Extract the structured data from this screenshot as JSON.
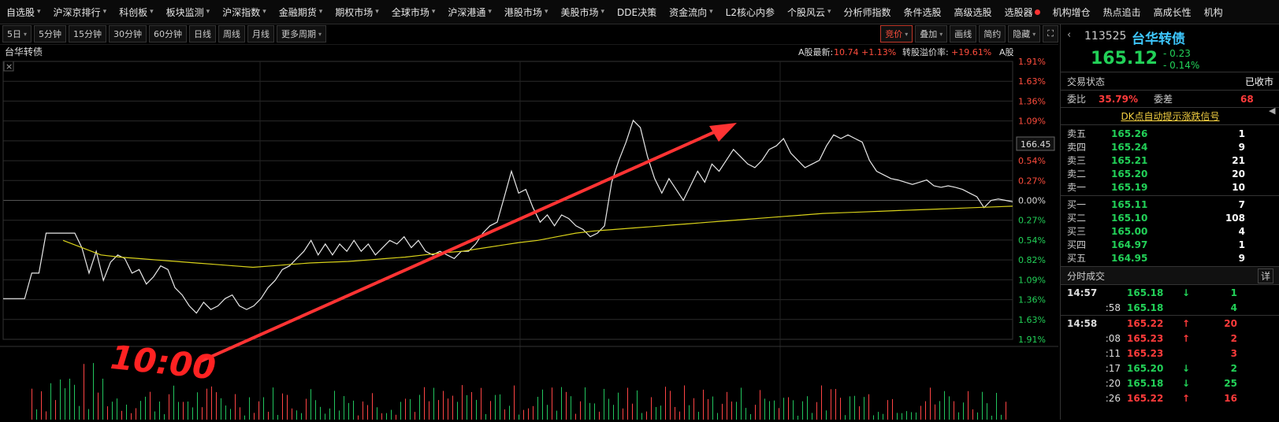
{
  "menu": [
    {
      "label": "自选股",
      "arrow": true
    },
    {
      "label": "沪深京排行",
      "arrow": true
    },
    {
      "label": "科创板",
      "arrow": true
    },
    {
      "label": "板块监测",
      "arrow": true
    },
    {
      "label": "沪深指数",
      "arrow": true
    },
    {
      "label": "金融期货",
      "arrow": true
    },
    {
      "label": "期权市场",
      "arrow": true
    },
    {
      "label": "全球市场",
      "arrow": true
    },
    {
      "label": "沪深港通",
      "arrow": true
    },
    {
      "label": "港股市场",
      "arrow": true
    },
    {
      "label": "美股市场",
      "arrow": true
    },
    {
      "label": "DDE决策",
      "arrow": false
    },
    {
      "label": "资金流向",
      "arrow": true
    },
    {
      "label": "L2核心内参",
      "arrow": false
    },
    {
      "label": "个股风云",
      "arrow": true
    },
    {
      "label": "分析师指数",
      "arrow": false
    },
    {
      "label": "条件选股",
      "arrow": false
    },
    {
      "label": "高级选股",
      "arrow": false
    },
    {
      "label": "选股器",
      "arrow": false,
      "dot": true
    },
    {
      "label": "机构增仓",
      "arrow": false
    },
    {
      "label": "热点追击",
      "arrow": false
    },
    {
      "label": "高成长性",
      "arrow": false
    },
    {
      "label": "机构",
      "arrow": false
    }
  ],
  "periods": [
    {
      "label": "5日",
      "arrow": true
    },
    {
      "label": "5分钟"
    },
    {
      "label": "15分钟"
    },
    {
      "label": "30分钟"
    },
    {
      "label": "60分钟"
    },
    {
      "label": "日线"
    },
    {
      "label": "周线"
    },
    {
      "label": "月线"
    },
    {
      "label": "更多周期",
      "arrow": true
    }
  ],
  "right_tools": [
    {
      "label": "竞价",
      "arrow": true,
      "active": true
    },
    {
      "label": "叠加",
      "arrow": true
    },
    {
      "label": "画线"
    },
    {
      "label": "简约"
    },
    {
      "label": "隐藏",
      "arrow": true
    }
  ],
  "chart": {
    "name": "台华转债",
    "a_share_label": "A股最新:",
    "a_share_price": "10.74",
    "a_share_change": "+1.13%",
    "premium_label": "转股溢价率:",
    "premium_value": "+19.61%",
    "truncated": "A股",
    "close_mark": "×",
    "price_tag": "166.45",
    "annotation": "10:00",
    "right_axis": [
      "1.91%",
      "1.63%",
      "1.36%",
      "1.09%",
      "0.82%",
      "0.54%",
      "0.27%",
      "0.00%",
      "0.27%",
      "0.54%",
      "0.82%",
      "1.09%",
      "1.36%",
      "1.63%",
      "1.91%"
    ]
  },
  "chart_data": {
    "type": "line",
    "ylabel": "",
    "ylim": [
      -1.91,
      1.91
    ],
    "series": [
      {
        "name": "",
        "values": [
          -1.35,
          -1.35,
          -1.35,
          -1.35,
          -1.0,
          -1.0,
          -0.45,
          -0.45,
          -0.45,
          -0.45,
          -0.45,
          -0.65,
          -1.0,
          -0.7,
          -1.1,
          -0.85,
          -0.75,
          -0.8,
          -1.0,
          -0.95,
          -1.15,
          -1.05,
          -0.9,
          -0.95,
          -1.2,
          -1.3,
          -1.45,
          -1.55,
          -1.4,
          -1.5,
          -1.45,
          -1.35,
          -1.3,
          -1.45,
          -1.5,
          -1.45,
          -1.35,
          -1.2,
          -1.1,
          -0.95,
          -0.9,
          -0.8,
          -0.7,
          -0.55,
          -0.75,
          -0.6,
          -0.75,
          -0.6,
          -0.7,
          -0.55,
          -0.7,
          -0.6,
          -0.75,
          -0.65,
          -0.55,
          -0.6,
          -0.5,
          -0.65,
          -0.55,
          -0.7,
          -0.75,
          -0.7,
          -0.75,
          -0.8,
          -0.7,
          -0.7,
          -0.6,
          -0.45,
          -0.35,
          -0.3,
          0.05,
          0.4,
          0.1,
          0.15,
          -0.1,
          -0.3,
          -0.2,
          -0.35,
          -0.2,
          -0.25,
          -0.35,
          -0.4,
          -0.5,
          -0.45,
          -0.35,
          0.25,
          0.55,
          0.8,
          1.1,
          1.0,
          0.6,
          0.3,
          0.1,
          0.3,
          0.15,
          0.0,
          0.2,
          0.4,
          0.25,
          0.5,
          0.4,
          0.55,
          0.7,
          0.6,
          0.5,
          0.45,
          0.55,
          0.7,
          0.75,
          0.85,
          0.65,
          0.55,
          0.45,
          0.5,
          0.55,
          0.75,
          0.9,
          0.85,
          0.9,
          0.85,
          0.8,
          0.55,
          0.4,
          0.35,
          0.3,
          0.28,
          0.25,
          0.22,
          0.25,
          0.28,
          0.2,
          0.18,
          0.2,
          0.18,
          0.15,
          0.1,
          0.05,
          -0.1,
          0.0,
          0.02,
          0.0,
          -0.02
        ],
        "color": "#e8e8e8"
      },
      {
        "name": "",
        "values": [
          -0.55,
          -0.65,
          -0.75,
          -0.78,
          -0.8,
          -0.82,
          -0.84,
          -0.86,
          -0.88,
          -0.9,
          -0.92,
          -0.9,
          -0.88,
          -0.86,
          -0.85,
          -0.84,
          -0.82,
          -0.8,
          -0.78,
          -0.75,
          -0.72,
          -0.7,
          -0.66,
          -0.62,
          -0.58,
          -0.55,
          -0.5,
          -0.45,
          -0.42,
          -0.4,
          -0.38,
          -0.36,
          -0.34,
          -0.32,
          -0.3,
          -0.28,
          -0.26,
          -0.24,
          -0.22,
          -0.2,
          -0.18,
          -0.17,
          -0.16,
          -0.15,
          -0.14,
          -0.13,
          -0.12,
          -0.11,
          -0.1,
          -0.09,
          -0.08
        ],
        "color": "#d9d21a"
      }
    ]
  },
  "quote": {
    "code": "113525",
    "name": "台华转债",
    "price": "165.12",
    "change": "- 0.23",
    "change_pct": "- 0.14%",
    "status_label": "交易状态",
    "status_value": "已收市",
    "weibi_label": "委比",
    "weibi_value": "35.79%",
    "weicha_label": "委差",
    "weicha_value": "68",
    "signal": "DK点自动提示涨跌信号",
    "sells": [
      {
        "label": "卖五",
        "price": "165.26",
        "vol": "1"
      },
      {
        "label": "卖四",
        "price": "165.24",
        "vol": "9"
      },
      {
        "label": "卖三",
        "price": "165.21",
        "vol": "21"
      },
      {
        "label": "卖二",
        "price": "165.20",
        "vol": "20"
      },
      {
        "label": "卖一",
        "price": "165.19",
        "vol": "10"
      }
    ],
    "buys": [
      {
        "label": "买一",
        "price": "165.11",
        "vol": "7"
      },
      {
        "label": "买二",
        "price": "165.10",
        "vol": "108"
      },
      {
        "label": "买三",
        "price": "165.00",
        "vol": "4"
      },
      {
        "label": "买四",
        "price": "164.97",
        "vol": "1"
      },
      {
        "label": "买五",
        "price": "164.95",
        "vol": "9"
      }
    ],
    "ticks_title": "分时成交",
    "ticks_detail": "详",
    "ticks": [
      {
        "time": "14:57",
        "price": "165.18",
        "dir": "down",
        "vol": "1",
        "color": "grn"
      },
      {
        "time": ":58",
        "price": "165.18",
        "dir": "",
        "vol": "4",
        "color": "grn"
      },
      {
        "time": "14:58",
        "price": "165.22",
        "dir": "up",
        "vol": "20",
        "color": "red"
      },
      {
        "time": ":08",
        "price": "165.23",
        "dir": "up",
        "vol": "2",
        "color": "red"
      },
      {
        "time": ":11",
        "price": "165.23",
        "dir": "",
        "vol": "3",
        "color": "red"
      },
      {
        "time": ":17",
        "price": "165.20",
        "dir": "down",
        "vol": "2",
        "color": "grn"
      },
      {
        "time": ":20",
        "price": "165.18",
        "dir": "down",
        "vol": "25",
        "color": "grn"
      },
      {
        "time": ":26",
        "price": "165.22",
        "dir": "up",
        "vol": "16",
        "color": "red"
      }
    ],
    "side_glyph": "◀"
  }
}
